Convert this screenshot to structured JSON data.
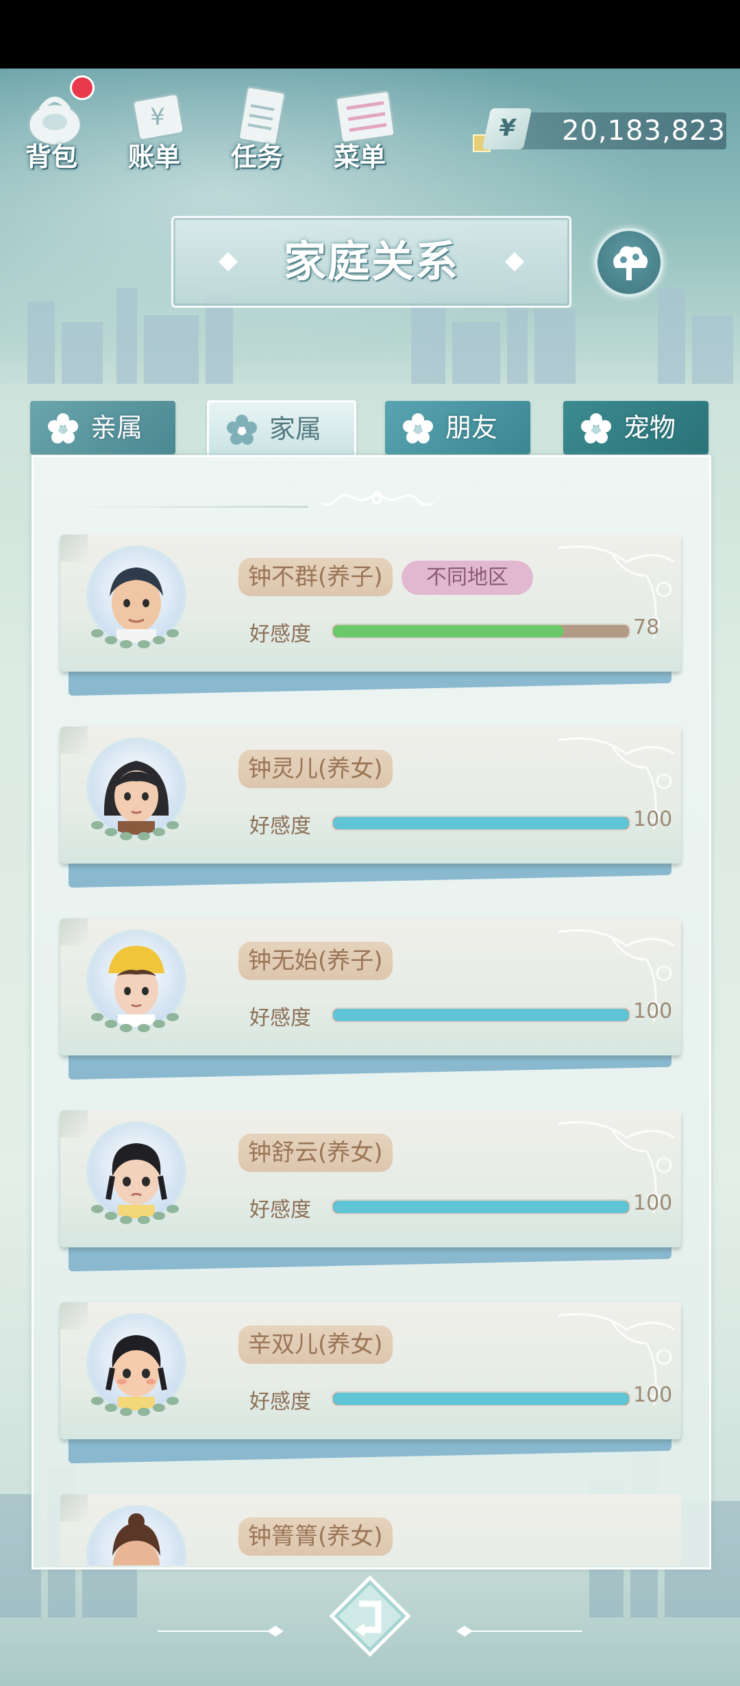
{
  "top_menu": [
    {
      "label": "背包",
      "icon": "backpack-icon",
      "has_badge": true
    },
    {
      "label": "账单",
      "icon": "bill-icon",
      "has_badge": false
    },
    {
      "label": "任务",
      "icon": "task-icon",
      "has_badge": false
    },
    {
      "label": "菜单",
      "icon": "menu-icon",
      "has_badge": false
    }
  ],
  "currency": {
    "symbol": "¥",
    "amount": "20,183,823"
  },
  "title": "家庭关系",
  "tabs": [
    {
      "label": "亲属",
      "selected": false
    },
    {
      "label": "家属",
      "selected": true
    },
    {
      "label": "朋友",
      "selected": false
    },
    {
      "label": "宠物",
      "selected": false
    }
  ],
  "favor_label": "好感度",
  "members": [
    {
      "name": "钟不群(养子)",
      "tag": "不同地区",
      "favor": 78,
      "favor_text": "78",
      "bar_color": "#6cc96a"
    },
    {
      "name": "钟灵儿(养女)",
      "tag": "",
      "favor": 100,
      "favor_text": "100",
      "bar_color": "#5ec4d6"
    },
    {
      "name": "钟无始(养子)",
      "tag": "",
      "favor": 100,
      "favor_text": "100",
      "bar_color": "#5ec4d6"
    },
    {
      "name": "钟舒云(养女)",
      "tag": "",
      "favor": 100,
      "favor_text": "100",
      "bar_color": "#5ec4d6"
    },
    {
      "name": "辛双儿(养女)",
      "tag": "",
      "favor": 100,
      "favor_text": "100",
      "bar_color": "#5ec4d6"
    },
    {
      "name": "钟箐箐(养女)",
      "tag": "",
      "favor": null,
      "favor_text": "",
      "bar_color": "#5ec4d6"
    }
  ],
  "colors": {
    "accent": "#4b8891",
    "tag_pink": "#e1b8d0",
    "name_chip": "#e6d3bd"
  }
}
